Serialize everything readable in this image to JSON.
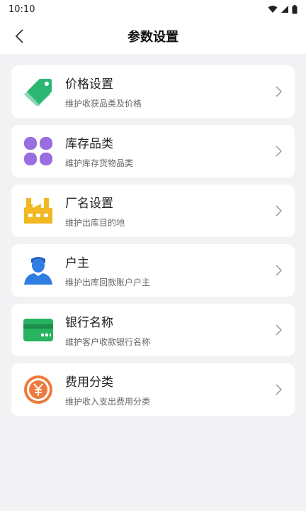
{
  "status_bar": {
    "time": "10:10"
  },
  "header": {
    "title": "参数设置"
  },
  "items": [
    {
      "title": "价格设置",
      "desc": "维护收获品类及价格",
      "icon": "price-tag-icon"
    },
    {
      "title": "库存品类",
      "desc": "维护库存货物品类",
      "icon": "category-grid-icon"
    },
    {
      "title": "厂名设置",
      "desc": "维护出库目的地",
      "icon": "factory-icon"
    },
    {
      "title": "户主",
      "desc": "维护出库回款账户户主",
      "icon": "person-icon"
    },
    {
      "title": "银行名称",
      "desc": "维护客户收款银行名称",
      "icon": "bank-card-icon"
    },
    {
      "title": "费用分类",
      "desc": "维护收入支出费用分类",
      "icon": "yuan-coin-icon"
    }
  ],
  "colors": {
    "price_tag": "#2bb673",
    "category": "#9a6de0",
    "factory": "#f2b824",
    "person": "#2f7de1",
    "bank_card": "#27b35f",
    "coin": "#ee7a3c"
  }
}
